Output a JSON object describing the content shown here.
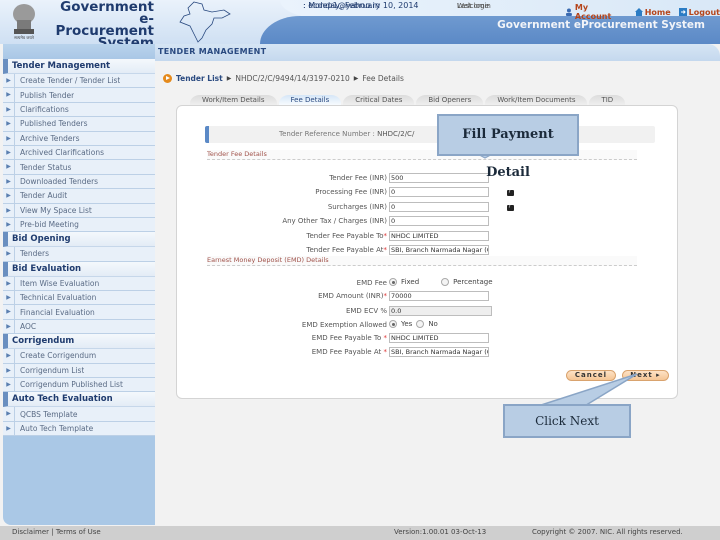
{
  "header": {
    "logo_lines": [
      "Government",
      "e-Procurement",
      "System"
    ],
    "emblem_caption": "सत्यमेव जयते",
    "welcome_label": "Welcome",
    "welcome_value": ": ecdep1@yahoo.in",
    "last_login_label": "Last login",
    "last_login_value": ": Monday, February 10, 2014",
    "links": [
      {
        "label": "My Account",
        "icon": "user-icon"
      },
      {
        "label": "Home",
        "icon": "home-icon"
      },
      {
        "label": "Logout",
        "icon": "logout-icon"
      }
    ],
    "system_title": "Government eProcurement System"
  },
  "sidebar": {
    "sections": [
      {
        "title": "Tender Management",
        "items": [
          "Create Tender / Tender List",
          "Publish Tender",
          "Clarifications",
          "Published Tenders",
          "Archive Tenders",
          "Archived Clarifications",
          "Tender Status",
          "Downloaded Tenders",
          "Tender Audit",
          "View My Space List",
          "Pre-bid Meeting"
        ]
      },
      {
        "title": "Bid Opening",
        "items": [
          "Tenders"
        ]
      },
      {
        "title": "Bid Evaluation",
        "items": [
          "Item Wise Evaluation",
          "Technical Evaluation",
          "Financial Evaluation",
          "AOC"
        ]
      },
      {
        "title": "Corrigendum",
        "items": [
          "Create Corrigendum",
          "Corrigendum List",
          "Corrigendum Published List"
        ]
      },
      {
        "title": "Auto Tech Evaluation",
        "items": [
          "QCBS Template",
          "Auto Tech Template"
        ]
      }
    ]
  },
  "main": {
    "section_title": "TENDER MANAGEMENT",
    "breadcrumb": [
      "Tender List",
      "NHDC/2/C/9494/14/3197-0210",
      "Fee Details"
    ],
    "tabs": [
      {
        "label": "Work/Item Details",
        "active": false
      },
      {
        "label": "Fee Details",
        "active": true
      },
      {
        "label": "Critical Dates",
        "active": false
      },
      {
        "label": "Bid Openers",
        "active": false
      },
      {
        "label": "Work/Item Documents",
        "active": false
      },
      {
        "label": "TID",
        "active": false
      }
    ],
    "reference_label": "Tender Reference Number :",
    "reference_value": "NHDC/2/C/",
    "tender_fee_section": "Tender Fee Details",
    "tender_fee_rows": [
      {
        "label": "Tender Fee (INR)",
        "value": "500",
        "required": false
      },
      {
        "label": "Processing Fee (INR)",
        "value": "0",
        "required": false
      },
      {
        "label": "Surcharges (INR)",
        "value": "0",
        "required": false
      },
      {
        "label": "Any Other Tax / Charges (INR)",
        "value": "0",
        "required": false
      },
      {
        "label": "Tender Fee Payable To",
        "value": "NHDC LIMITED",
        "required": true
      },
      {
        "label": "Tender Fee Payable At",
        "value": "SBI, Branch Narmada Nagar (C)",
        "required": true
      }
    ],
    "emd_section": "Earnest Money Deposit (EMD) Details",
    "emd_fee_label": "EMD Fee",
    "emd_fee_options": [
      "Fixed",
      "Percentage"
    ],
    "emd_fee_selected": "Fixed",
    "emd_amount_label": "EMD Amount (INR)",
    "emd_amount_value": "70000",
    "emd_ecv_label": "EMD ECV %",
    "emd_ecv_value": "0.0",
    "emd_exemption_label": "EMD Exemption Allowed",
    "emd_exemption_options": [
      "Yes",
      "No"
    ],
    "emd_exemption_selected": "Yes",
    "emd_payable_to_label": "EMD Fee Payable To",
    "emd_payable_to_value": "NHDC LIMITED",
    "emd_payable_at_label": "EMD Fee Payable At",
    "emd_payable_at_value": "SBI, Branch Narmada Nagar (C",
    "cancel_label": "Cancel",
    "next_label": "Next ▸"
  },
  "callouts": {
    "fill_payment": "Fill Payment Detail",
    "click_next": "Click Next"
  },
  "footer": {
    "links": "Disclaimer  |  Terms of Use",
    "version": "Version:1.00.01 03-Oct-13",
    "copyright": "Copyright © 2007. NIC. All rights reserved."
  },
  "colors": {
    "accent_blue": "#5b89c6",
    "link_orange": "#b5451b",
    "button_peach": "#f5c595",
    "callout_fill": "#b8cde4"
  }
}
